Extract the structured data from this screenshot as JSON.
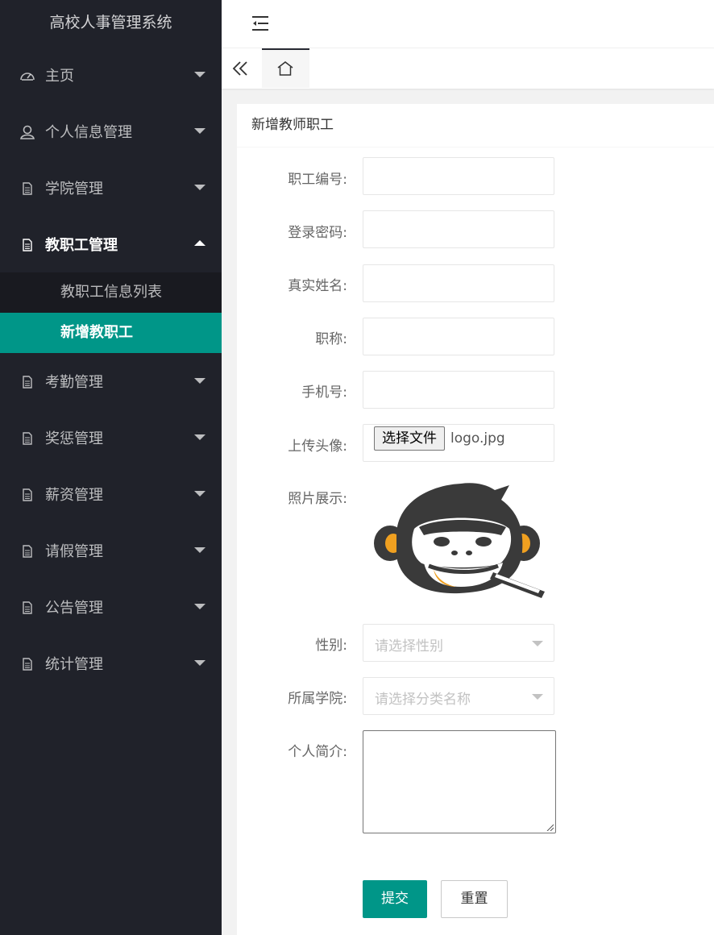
{
  "app_title": "高校人事管理系统",
  "sidebar": {
    "items": [
      {
        "label": "主页"
      },
      {
        "label": "个人信息管理"
      },
      {
        "label": "学院管理"
      },
      {
        "label": "教职工管理"
      },
      {
        "label": "考勤管理"
      },
      {
        "label": "奖惩管理"
      },
      {
        "label": "薪资管理"
      },
      {
        "label": "请假管理"
      },
      {
        "label": "公告管理"
      },
      {
        "label": "统计管理"
      }
    ],
    "sub_items": [
      {
        "label": "教职工信息列表"
      },
      {
        "label": "新增教职工"
      }
    ]
  },
  "form": {
    "title": "新增教师职工",
    "labels": {
      "emp_no": "职工编号:",
      "password": "登录密码:",
      "real_name": "真实姓名:",
      "job_title": "职称:",
      "phone": "手机号:",
      "avatar": "上传头像:",
      "photo": "照片展示:",
      "gender": "性别:",
      "college": "所属学院:",
      "intro": "个人简介:"
    },
    "file_button": "选择文件",
    "file_name": "logo.jpg",
    "gender_placeholder": "请选择性别",
    "college_placeholder": "请选择分类名称",
    "submit": "提交",
    "reset": "重置"
  },
  "colors": {
    "accent": "#009688",
    "sidebar_bg": "#20222a"
  }
}
